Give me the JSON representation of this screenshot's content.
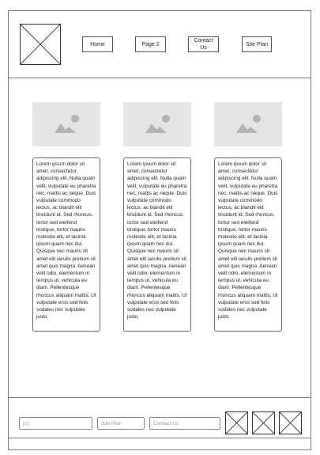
{
  "header": {
    "logo_icon": "placeholder-x-icon",
    "nav": [
      {
        "label": "Home"
      },
      {
        "label": "Page 2"
      },
      {
        "label": "Contact Us"
      },
      {
        "label": "Site Plan"
      }
    ]
  },
  "cards": [
    {
      "image_icon": "image-placeholder-icon",
      "text": "Lorem ipsum dolor sit amet, consectetur adipiscing elit. Nulla quam velit, vulputate eu pharetra nec, mattis ac neque. Duis vulputate commodo lectus, ac blandit elit tincidunt id. Sed rhoncus, tortor sed eleifend tristique, tortor mauris molestie elit, et lacinia ipsum quam nec dui. Quisque nec mauris sit amet elit iaculis pretium sit amet quis magna. Aenean velit odio, elementum in tempus ut, vehicula eu diam. Pellentesque rhoncus aliquam mattis. Ut vulputate eros sed felis sodales nec vulputate justo"
    },
    {
      "image_icon": "image-placeholder-icon",
      "text": "Lorem ipsum dolor sit amet, consectetur adipiscing elit. Nulla quam velit, vulputate eu pharetra nec, mattis ac neque. Duis vulputate commodo lectus, ac blandit elit tincidunt id. Sed rhoncus, tortor sed eleifend tristique, tortor mauris molestie elit, et lacinia ipsum quam nec dui. Quisque nec mauris sit amet elit iaculis pretium sit amet quis magna. Aenean velit odio, elementum in tempus ut, vehicula eu diam. Pellentesque rhoncus aliquam mattis. Ut vulputate eros sed felis sodales nec vulputate justo"
    },
    {
      "image_icon": "image-placeholder-icon",
      "text": "Lorem ipsum dolor sit amet, consectetur adipiscing elit. Nulla quam velit, vulputate eu pharetra nec, mattis ac neque. Duis vulputate commodo lectus, ac blandit elit tincidunt id. Sed rhoncus, tortor sed eleifend tristique, tortor mauris molestie elit, et lacinia ipsum quam nec dui. Quisque nec mauris sit amet elit iaculis pretium sit amet quis magna. Aenean velit odio, elementum in tempus ut, vehicula eu diam. Pellentesque rhoncus aliquam mattis. Ut vulputate eros sed felis sodales nec vulputate justo"
    }
  ],
  "footer": {
    "copyright": "(c)",
    "site_plan": "Site Plan",
    "contact_us": "Contact Us",
    "social_icons": [
      "placeholder-x-icon",
      "placeholder-x-icon",
      "placeholder-x-icon"
    ]
  },
  "colors": {
    "border": "#7a7a7a",
    "image_placeholder_bg": "#e5e5e5",
    "image_placeholder_fg": "#b3b3b3"
  }
}
